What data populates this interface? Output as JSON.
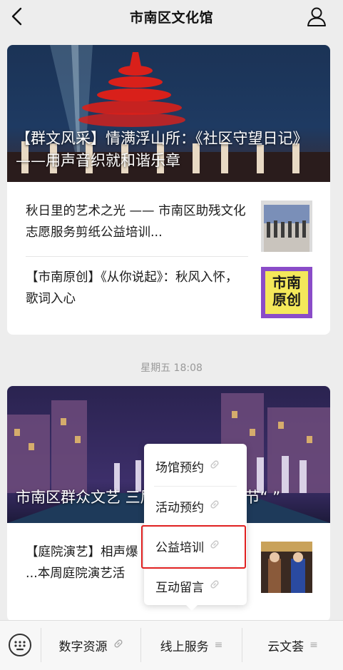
{
  "header": {
    "title": "市南区文化馆"
  },
  "card1": {
    "hero_title": "【群文风采】情满浮山所：《社区守望日记》——用声音织就和谐乐章",
    "items": [
      {
        "text": "秋日里的艺术之光 —— 市南区助残文化志愿服务剪纸公益培训..."
      },
      {
        "text": "【市南原创】《从你说起》：秋风入怀，歌词入心",
        "thumb_text": "市南原创"
      }
    ]
  },
  "timestamp": "星期五 18:08",
  "card2": {
    "hero_title": "市南区群众文艺           三届山东文化艺术节“           ”",
    "items": [
      {
        "text": "【庭院演艺】相声爆\n...本周庭院演艺活"
      }
    ]
  },
  "popup": {
    "items": [
      "场馆预约",
      "活动预约",
      "公益培训",
      "互动留言"
    ]
  },
  "bottombar": {
    "items": [
      "数字资源",
      "线上服务",
      "云文荟"
    ]
  },
  "colors": {
    "highlight": "#e02020",
    "background": "#ededed"
  }
}
